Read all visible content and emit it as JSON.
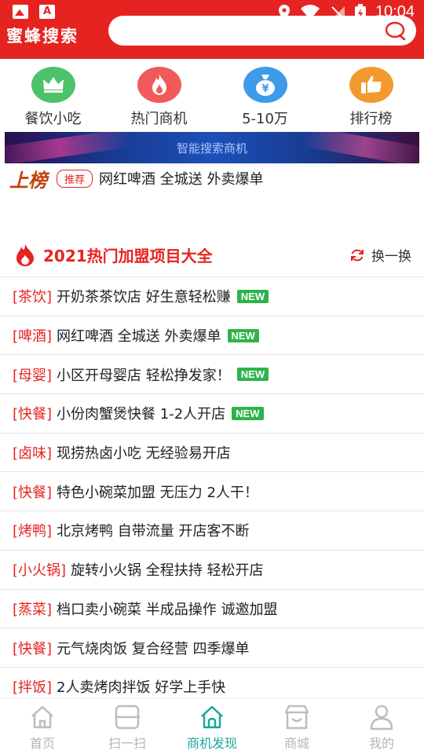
{
  "status_bar": {
    "time": "10:04"
  },
  "header": {
    "brand": "蜜蜂搜索",
    "search_placeholder": ""
  },
  "categories": [
    {
      "label": "餐饮小吃",
      "color": "#4cc26a",
      "icon": "crown-icon"
    },
    {
      "label": "热门商机",
      "color": "#f05a5a",
      "icon": "flame-icon"
    },
    {
      "label": "5-10万",
      "color": "#3d9be9",
      "icon": "money-bag-icon"
    },
    {
      "label": "排行榜",
      "color": "#f39a2e",
      "icon": "thumbs-up-icon"
    }
  ],
  "banner": {
    "text": "智能搜索商机"
  },
  "ticker": {
    "logo": "上榜",
    "tag": "推荐",
    "text": "网红啤酒 全城送 外卖爆单"
  },
  "section": {
    "title": "2021热门加盟项目大全",
    "refresh_label": "换一换"
  },
  "list": [
    {
      "category": "[茶饮]",
      "title": "开奶茶茶饮店 好生意轻松赚",
      "badge": "NEW"
    },
    {
      "category": "[啤酒]",
      "title": "网红啤酒 全城送 外卖爆单",
      "badge": "NEW"
    },
    {
      "category": "[母婴]",
      "title": "小区开母婴店 轻松挣发家！",
      "badge": "NEW"
    },
    {
      "category": "[快餐]",
      "title": "小份肉蟹煲快餐 1-2人开店",
      "badge": "NEW"
    },
    {
      "category": "[卤味]",
      "title": "现捞热卤小吃 无经验易开店",
      "badge": ""
    },
    {
      "category": "[快餐]",
      "title": "特色小碗菜加盟 无压力 2人干！",
      "badge": ""
    },
    {
      "category": "[烤鸭]",
      "title": "北京烤鸭 自带流量 开店客不断",
      "badge": ""
    },
    {
      "category": "[小火锅]",
      "title": "旋转小火锅 全程扶持 轻松开店",
      "badge": ""
    },
    {
      "category": "[蒸菜]",
      "title": "档口卖小碗菜 半成品操作 诚邀加盟",
      "badge": ""
    },
    {
      "category": "[快餐]",
      "title": "元气烧肉饭 复合经营 四季爆单",
      "badge": ""
    },
    {
      "category": "[拌饭]",
      "title": "2人卖烤肉拌饭 好学上手快",
      "badge": ""
    }
  ],
  "bottom_nav": [
    {
      "label": "首页",
      "icon": "home-icon",
      "active": false
    },
    {
      "label": "扫一扫",
      "icon": "scan-icon",
      "active": false
    },
    {
      "label": "商机发现",
      "icon": "discover-home-icon",
      "active": true
    },
    {
      "label": "商城",
      "icon": "store-icon",
      "active": false
    },
    {
      "label": "我的",
      "icon": "user-icon",
      "active": false
    }
  ],
  "colors": {
    "brand_red": "#e52422",
    "new_green": "#2eb34a",
    "nav_active": "#1aa89a"
  }
}
